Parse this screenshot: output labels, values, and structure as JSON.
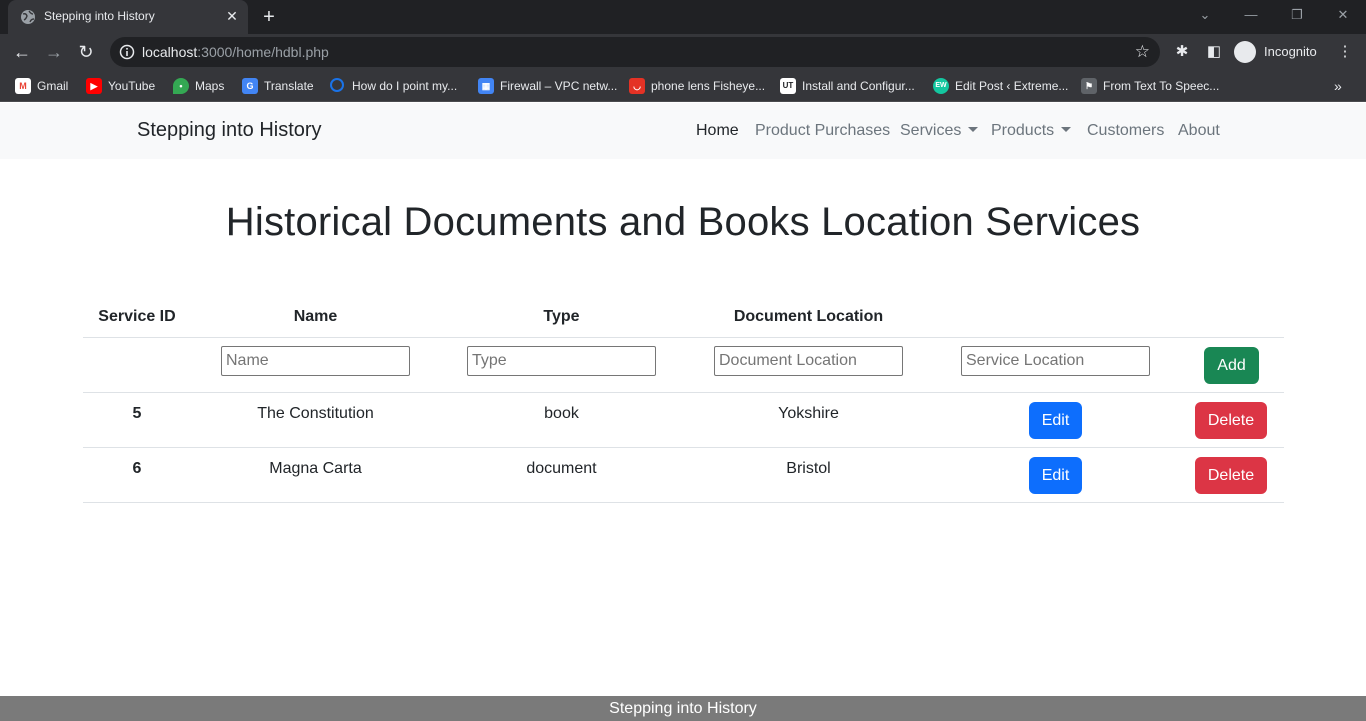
{
  "browser": {
    "tab_title": "Stepping into History",
    "tab_close": "✕",
    "new_tab": "+",
    "url_host": "localhost",
    "url_path": ":3000/home/hdbl.php",
    "profile_label": "Incognito",
    "bookmarks": [
      {
        "label": "Gmail",
        "icon": "gmail-icon",
        "color": "#ea4335"
      },
      {
        "label": "YouTube",
        "icon": "youtube-icon",
        "color": "#ff0000"
      },
      {
        "label": "Maps",
        "icon": "maps-icon",
        "color": "#34a853"
      },
      {
        "label": "Translate",
        "icon": "translate-icon",
        "color": "#4285f4"
      },
      {
        "label": "How do I point my...",
        "icon": "loading-icon",
        "color": "#1a73e8"
      },
      {
        "label": "Firewall – VPC netw...",
        "icon": "network-icon",
        "color": "#4285f4"
      },
      {
        "label": "phone lens Fisheye...",
        "icon": "aliexpress-icon",
        "color": "#e43225"
      },
      {
        "label": "Install and Configur...",
        "icon": "ut-icon",
        "color": "#ffffff"
      },
      {
        "label": "Edit Post ‹ Extreme...",
        "icon": "ew-icon",
        "color": "#14c7a0"
      },
      {
        "label": "From Text To Speec...",
        "icon": "speech-icon",
        "color": "#8ab4f8"
      }
    ],
    "bookmarks_more": "»"
  },
  "site": {
    "brand": "Stepping into History",
    "nav": {
      "home": "Home",
      "product_purchases": "Product Purchases",
      "services": "Services",
      "products": "Products",
      "customers": "Customers",
      "about": "About"
    },
    "page_title": "Historical Documents and Books Location Services",
    "table": {
      "headers": {
        "service_id": "Service ID",
        "name": "Name",
        "type": "Type",
        "document_location": "Document Location"
      },
      "form": {
        "name_placeholder": "Name",
        "type_placeholder": "Type",
        "document_location_placeholder": "Document Location",
        "service_location_placeholder": "Service Location",
        "add_label": "Add"
      },
      "rows": [
        {
          "id": "5",
          "name": "The Constitution",
          "type": "book",
          "location": "Yokshire",
          "edit": "Edit",
          "delete": "Delete"
        },
        {
          "id": "6",
          "name": "Magna Carta",
          "type": "document",
          "location": "Bristol",
          "edit": "Edit",
          "delete": "Delete"
        }
      ]
    },
    "footer": "Stepping into History"
  },
  "colors": {
    "add": "#198754",
    "edit": "#0d6efd",
    "delete": "#dc3545",
    "navbar_bg": "#f8f9fa",
    "footer_bg": "#7a7a7a"
  }
}
